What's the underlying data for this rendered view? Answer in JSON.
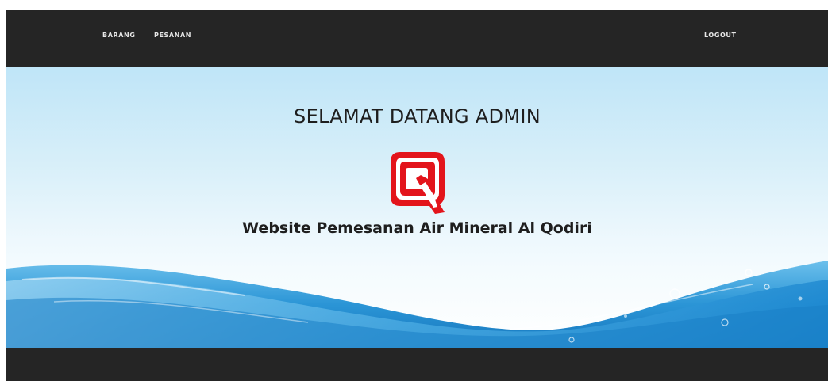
{
  "navbar": {
    "left_items": [
      {
        "label": "BARANG"
      },
      {
        "label": "PESANAN"
      }
    ],
    "logout_label": "LOGOUT"
  },
  "hero": {
    "welcome_title": "SELAMAT DATANG ADMIN",
    "logo_icon": "red-q-logo-icon",
    "subtitle": "Website Pemesanan Air Mineral Al Qodiri"
  },
  "colors": {
    "navbar_bg": "#252525",
    "logo_red": "#e3141b",
    "water_blue": "#1f8fd4"
  }
}
